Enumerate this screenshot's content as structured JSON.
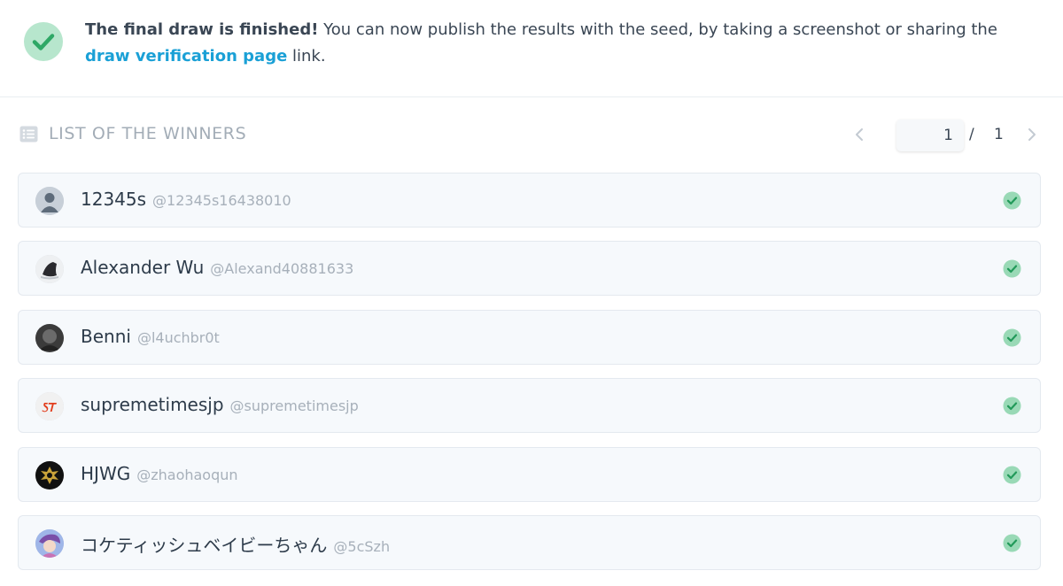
{
  "banner": {
    "bold_text": "The final draw is finished!",
    "text_before_link": " You can now publish the results with the seed, by taking a screenshot or sharing the ",
    "link_text": "draw verification page",
    "text_after_link": " link.",
    "accent_color": "#1aa0d6",
    "success_color": "#2ea866"
  },
  "list": {
    "title": "LIST OF THE WINNERS",
    "icon": "list-icon"
  },
  "pagination": {
    "current_page": "1",
    "separator": "/",
    "total_pages": "1",
    "prev_icon": "chevron-left-icon",
    "next_icon": "chevron-right-icon"
  },
  "winners": [
    {
      "name": "12345s",
      "handle": "@12345s16438010",
      "avatar": "default-user-avatar",
      "verified": true
    },
    {
      "name": "Alexander Wu",
      "handle": "@Alexand40881633",
      "avatar": "sneaker-avatar",
      "verified": true
    },
    {
      "name": "Benni",
      "handle": "@l4uchbr0t",
      "avatar": "dark-photo-avatar",
      "verified": true
    },
    {
      "name": "supremetimesjp",
      "handle": "@supremetimesjp",
      "avatar": "st-logo-avatar",
      "verified": true
    },
    {
      "name": "HJWG",
      "handle": "@zhaohaoqun",
      "avatar": "gold-emblem-avatar",
      "verified": true
    },
    {
      "name": "コケティッシュベイビーちゃん",
      "handle": "@5cSzh",
      "avatar": "anime-avatar",
      "verified": true
    }
  ]
}
